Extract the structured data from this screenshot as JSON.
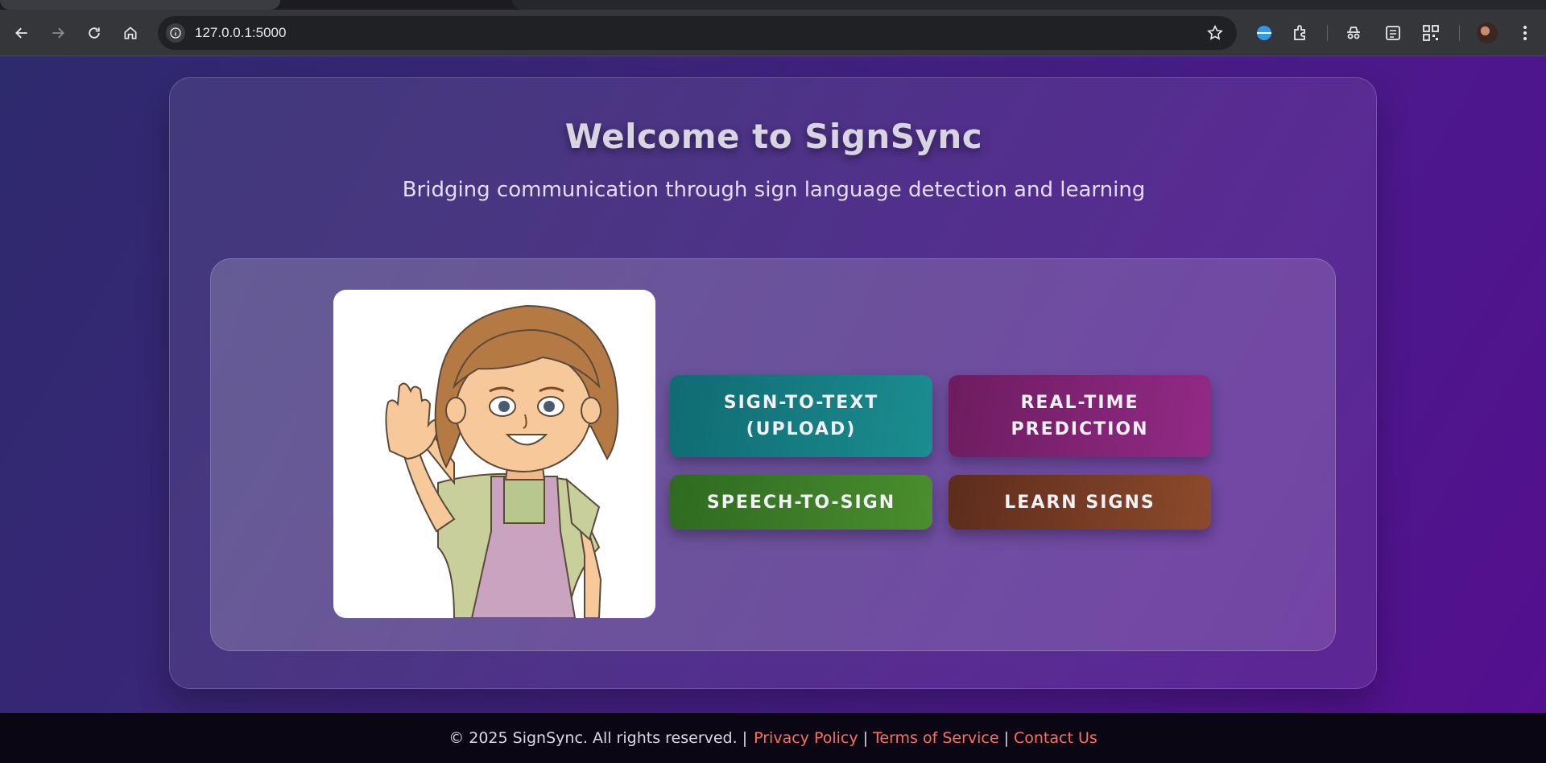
{
  "browser": {
    "url": "127.0.0.1:5000"
  },
  "hero": {
    "title": "Welcome to SignSync",
    "subtitle": "Bridging communication through sign language detection and learning"
  },
  "buttons": [
    {
      "label": "SIGN-TO-TEXT\n(UPLOAD)",
      "color_from": "#0f6b72",
      "color_to": "#1b8d90"
    },
    {
      "label": "REAL-TIME\nPREDICTION",
      "color_from": "#6d1c5f",
      "color_to": "#922a86"
    },
    {
      "label": "SPEECH-TO-SIGN",
      "color_from": "#2e6a20",
      "color_to": "#4a8e2e"
    },
    {
      "label": "LEARN SIGNS",
      "color_from": "#5d2c1c",
      "color_to": "#8c4a2a"
    }
  ],
  "footer": {
    "copyright": "© 2025 SignSync. All rights reserved. |",
    "links": [
      "Privacy Policy",
      "Terms of Service",
      "Contact Us"
    ],
    "link_color": "#ff6f61"
  },
  "icons": {
    "toolbar": [
      "back-icon",
      "forward-icon",
      "reload-icon",
      "home-icon",
      "site-info-icon",
      "bookmark-star-icon",
      "vpn-extension-icon",
      "extensions-icon",
      "incognito-icon",
      "reading-list-icon",
      "qr-code-icon",
      "profile-avatar",
      "menu-icon"
    ]
  }
}
